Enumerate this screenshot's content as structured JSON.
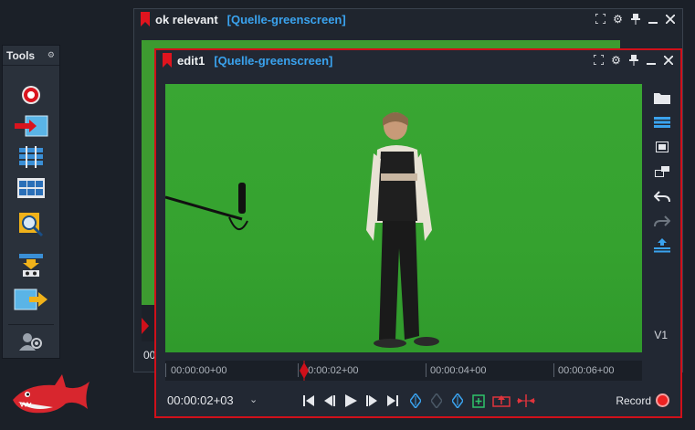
{
  "tools_panel": {
    "title": "Tools",
    "items": [
      {
        "name": "record-icon"
      },
      {
        "name": "import-icon"
      },
      {
        "name": "timeline-icon"
      },
      {
        "name": "storyboard-icon"
      },
      {
        "name": "search-icon"
      },
      {
        "name": "export-icon"
      },
      {
        "name": "output-icon"
      },
      {
        "name": "settings-users-icon"
      }
    ]
  },
  "back_window": {
    "title": "ok relevant",
    "source": "[Quelle-greenscreen]",
    "timecode": "00"
  },
  "front_window": {
    "title": "edit1",
    "source": "[Quelle-greenscreen]",
    "track_label": "V1",
    "timeline_labels": [
      "00:00:00+00",
      "00:00:02+00",
      "00:00:04+00",
      "00:00:06+00"
    ],
    "timecode": "00:00:02+03",
    "record_label": "Record"
  },
  "colors": {
    "accent_red": "#d0101a",
    "source_blue": "#3aa3ef",
    "greenscreen": "#37a431"
  }
}
